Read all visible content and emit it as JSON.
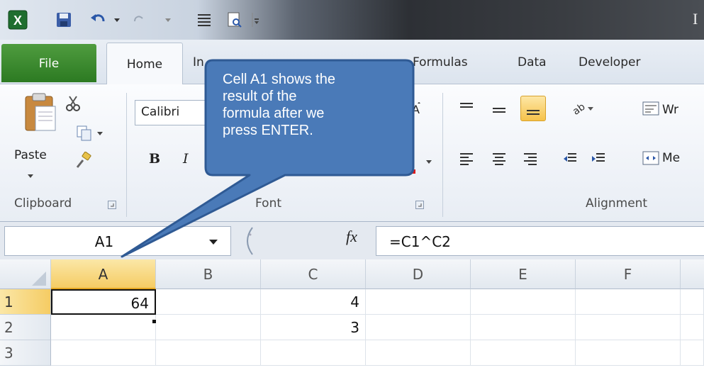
{
  "title": {
    "partial_letter": "I"
  },
  "ribbon": {
    "tabs": [
      "File",
      "Home",
      "In",
      "Formulas",
      "Data",
      "Developer"
    ],
    "clipboard": {
      "paste_label": "Paste",
      "group_label": "Clipboard"
    },
    "font": {
      "font_name": "Calibri",
      "bold": "B",
      "italic": "I",
      "group_label": "Font"
    },
    "alignment": {
      "wrap_label": "Wr",
      "merge_label": "Me",
      "group_label": "Alignment"
    }
  },
  "formula_bar": {
    "name_box": "A1",
    "fx_label": "fx",
    "formula": "=C1^C2"
  },
  "grid": {
    "columns": [
      "A",
      "B",
      "C",
      "D",
      "E",
      "F"
    ],
    "rows": [
      "1",
      "2",
      "3"
    ],
    "cells": {
      "A1": "64",
      "C1": "4",
      "C2": "3"
    },
    "active_column": "A",
    "active_row": "1"
  },
  "callout": {
    "lines": [
      "Cell A1 shows the",
      "result of the",
      "formula after we",
      "press ENTER."
    ],
    "fill": "#4a7ab8",
    "stroke": "#2f5a94"
  },
  "colors": {
    "file_tab": "#3a8a2e",
    "highlight": "#f5cc64"
  }
}
